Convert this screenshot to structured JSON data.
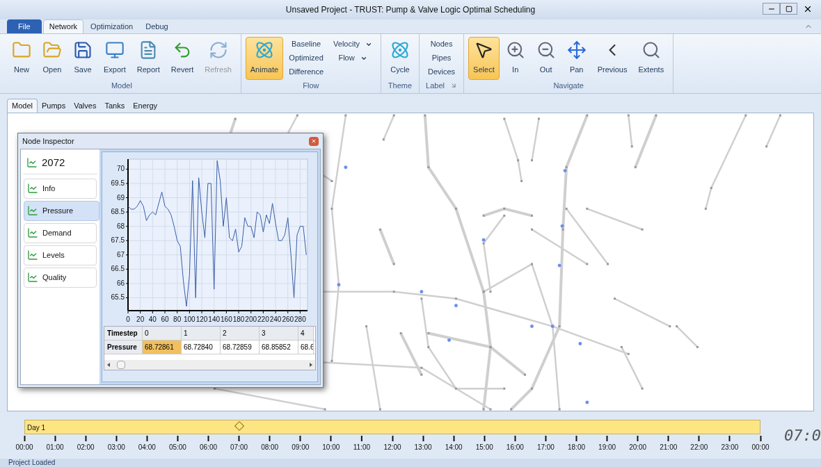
{
  "window": {
    "title": "Unsaved Project - TRUST: Pump & Valve Logic Optimal Scheduling"
  },
  "ribbon_tabs": [
    {
      "label": "File",
      "kind": "file",
      "selected": false
    },
    {
      "label": "Network",
      "kind": "tab",
      "selected": true
    },
    {
      "label": "Optimization",
      "kind": "tab",
      "selected": false
    },
    {
      "label": "Debug",
      "kind": "tab",
      "selected": false
    }
  ],
  "ribbon_groups": [
    {
      "title": "Model",
      "launcher": false,
      "items": [
        {
          "kind": "large",
          "label": "New",
          "selected": false,
          "disabled": false
        },
        {
          "kind": "large",
          "label": "Open",
          "selected": false,
          "disabled": false
        },
        {
          "kind": "large",
          "label": "Save",
          "selected": false,
          "disabled": false
        },
        {
          "kind": "large",
          "label": "Export",
          "selected": false,
          "disabled": false
        },
        {
          "kind": "large",
          "label": "Report",
          "selected": false,
          "disabled": false
        },
        {
          "kind": "large",
          "label": "Revert",
          "selected": false,
          "disabled": false
        },
        {
          "kind": "large",
          "label": "Refresh",
          "selected": false,
          "disabled": true
        }
      ]
    },
    {
      "title": "Flow",
      "launcher": false,
      "items": [
        {
          "kind": "large",
          "label": "Animate",
          "selected": true,
          "disabled": false
        },
        {
          "kind": "column",
          "entries": [
            {
              "label": "Baseline",
              "dropdown": false
            },
            {
              "label": "Optimized",
              "dropdown": false
            },
            {
              "label": "Difference",
              "dropdown": false
            }
          ]
        },
        {
          "kind": "column",
          "entries": [
            {
              "label": "Velocity",
              "dropdown": true
            },
            {
              "label": "Flow",
              "dropdown": true
            }
          ]
        }
      ]
    },
    {
      "title": "Theme",
      "launcher": false,
      "items": [
        {
          "kind": "large",
          "label": "Cycle",
          "selected": false,
          "disabled": false
        }
      ]
    },
    {
      "title": "Label",
      "launcher": true,
      "items": [
        {
          "kind": "column",
          "entries": [
            {
              "label": "Nodes",
              "dropdown": false
            },
            {
              "label": "Pipes",
              "dropdown": false
            },
            {
              "label": "Devices",
              "dropdown": false
            }
          ]
        }
      ]
    },
    {
      "title": "Navigate",
      "launcher": false,
      "items": [
        {
          "kind": "large",
          "label": "Select",
          "selected": true,
          "disabled": false
        },
        {
          "kind": "large",
          "label": "In",
          "selected": false,
          "disabled": false
        },
        {
          "kind": "large",
          "label": "Out",
          "selected": false,
          "disabled": false
        },
        {
          "kind": "large",
          "label": "Pan",
          "selected": false,
          "disabled": false
        },
        {
          "kind": "large",
          "label": "Previous",
          "selected": false,
          "disabled": false
        },
        {
          "kind": "large",
          "label": "Extents",
          "selected": false,
          "disabled": false
        }
      ]
    }
  ],
  "view_tabs": [
    {
      "label": "Model",
      "selected": true
    },
    {
      "label": "Pumps",
      "selected": false
    },
    {
      "label": "Valves",
      "selected": false
    },
    {
      "label": "Tanks",
      "selected": false
    },
    {
      "label": "Energy",
      "selected": false
    }
  ],
  "inspector": {
    "title": "Node Inspector",
    "node": "2072",
    "items": [
      {
        "label": "Info",
        "selected": false
      },
      {
        "label": "Pressure",
        "selected": true
      },
      {
        "label": "Demand",
        "selected": false
      },
      {
        "label": "Levels",
        "selected": false
      },
      {
        "label": "Quality",
        "selected": false
      }
    ],
    "chart_data": {
      "type": "line",
      "grid": true,
      "xlim": [
        0,
        292
      ],
      "ylim": [
        65.05,
        70.35
      ],
      "xticks": [
        0,
        20,
        40,
        60,
        80,
        100,
        120,
        140,
        160,
        180,
        200,
        220,
        240,
        260,
        280
      ],
      "yticks": [
        65.5,
        66,
        66.5,
        67,
        67.5,
        68,
        68.5,
        69,
        69.5,
        70
      ],
      "x": [
        0,
        5,
        10,
        15,
        20,
        25,
        30,
        35,
        40,
        45,
        50,
        55,
        60,
        65,
        70,
        75,
        80,
        85,
        90,
        95,
        100,
        105,
        110,
        115,
        120,
        125,
        130,
        135,
        140,
        145,
        150,
        155,
        160,
        165,
        170,
        175,
        180,
        185,
        190,
        195,
        200,
        205,
        210,
        215,
        220,
        225,
        230,
        235,
        240,
        245,
        250,
        255,
        260,
        265,
        270,
        275,
        280,
        285,
        290
      ],
      "series": [
        {
          "color": "#3a5ea8",
          "values": [
            68.7,
            68.6,
            68.6,
            68.7,
            68.9,
            68.7,
            68.2,
            68.4,
            68.5,
            68.4,
            68.8,
            69.2,
            68.7,
            68.6,
            68.4,
            68.0,
            67.5,
            67.3,
            66.1,
            65.2,
            66.3,
            69.6,
            65.5,
            69.7,
            68.5,
            67.6,
            69.5,
            69.5,
            65.8,
            70.3,
            69.6,
            68.0,
            69.0,
            67.6,
            67.5,
            67.9,
            67.1,
            67.3,
            68.3,
            68.0,
            68.0,
            67.6,
            68.5,
            68.4,
            67.8,
            68.4,
            68.1,
            68.8,
            68.1,
            67.5,
            67.5,
            67.7,
            68.3,
            67.0,
            65.5,
            67.7,
            68.0,
            68.0,
            67.0
          ]
        }
      ]
    },
    "table": {
      "row_headers": [
        "Timestep",
        "Pressure"
      ],
      "columns": [
        {
          "timestep": "0",
          "value": "68.72861",
          "selected": true
        },
        {
          "timestep": "1",
          "value": "68.72840",
          "selected": false
        },
        {
          "timestep": "2",
          "value": "68.72859",
          "selected": false
        },
        {
          "timestep": "3",
          "value": "68.85852",
          "selected": false
        },
        {
          "timestep": "4",
          "value": "68.6",
          "selected": false
        }
      ]
    }
  },
  "timeline": {
    "day": "Day 1",
    "level": 0.2917,
    "hours": [
      "00:00",
      "01:00",
      "02:00",
      "03:00",
      "04:00",
      "05:00",
      "06:00",
      "07:00",
      "08:00",
      "09:00",
      "10:00",
      "11:00",
      "12:00",
      "13:00",
      "14:00",
      "15:00",
      "16:00",
      "17:00",
      "18:00",
      "19:00",
      "20:00",
      "21:00",
      "22:00",
      "23:00",
      "00:00"
    ],
    "clock": "07:0"
  },
  "status_bar": "Project Loaded"
}
